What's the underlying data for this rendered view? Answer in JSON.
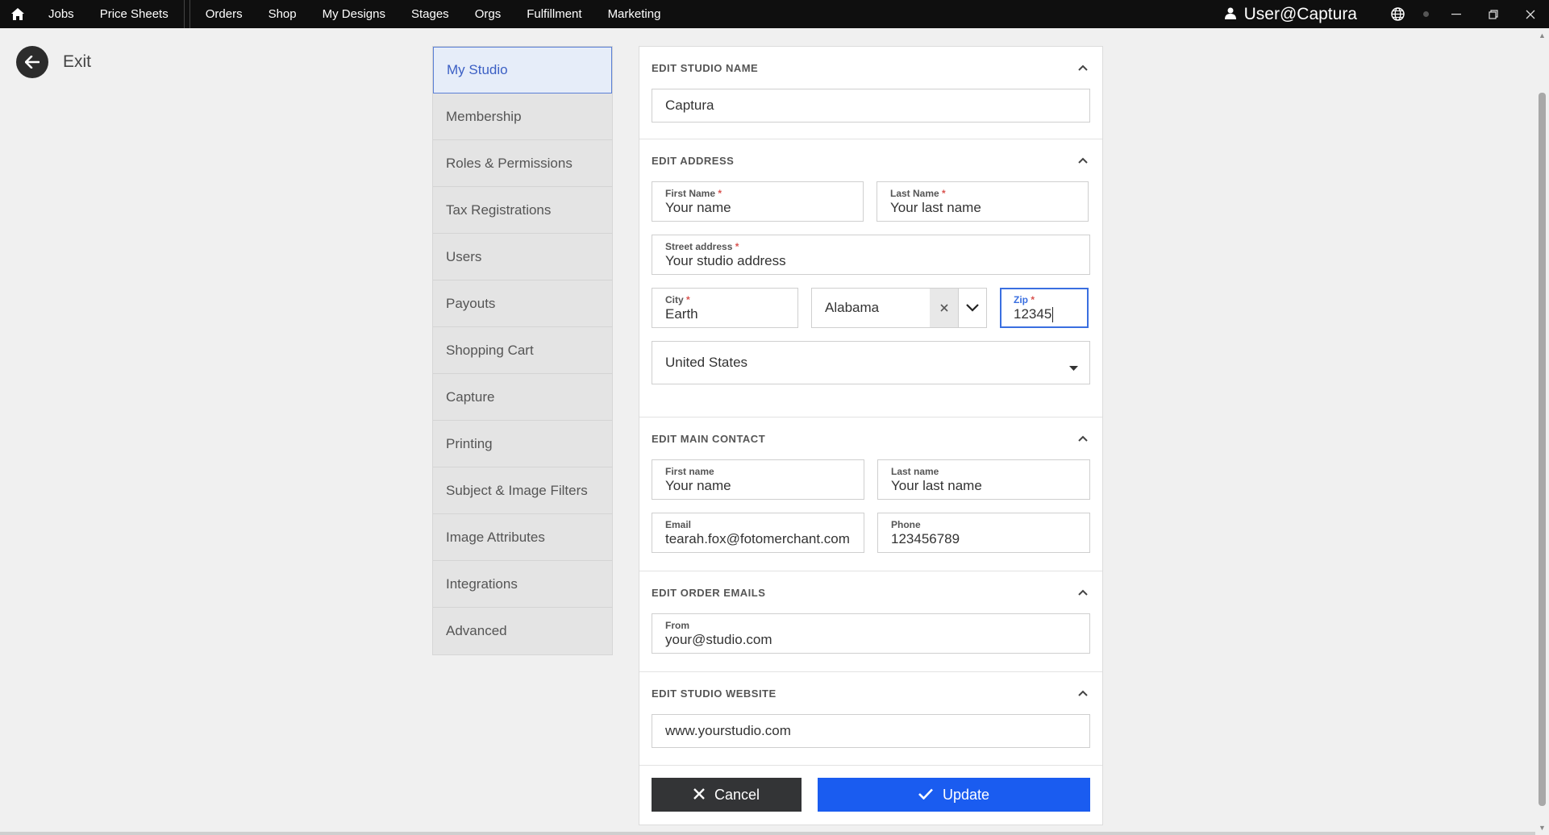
{
  "topbar": {
    "nav": [
      "Jobs",
      "Price Sheets",
      "Orders",
      "Shop",
      "My Designs",
      "Stages",
      "Orgs",
      "Fulfillment",
      "Marketing"
    ],
    "user": "User@Captura"
  },
  "exit_label": "Exit",
  "sidebar": {
    "items": [
      {
        "label": "My Studio",
        "active": true
      },
      {
        "label": "Membership"
      },
      {
        "label": "Roles & Permissions"
      },
      {
        "label": "Tax Registrations"
      },
      {
        "label": "Users"
      },
      {
        "label": "Payouts"
      },
      {
        "label": "Shopping Cart"
      },
      {
        "label": "Capture"
      },
      {
        "label": "Printing"
      },
      {
        "label": "Subject & Image Filters"
      },
      {
        "label": "Image Attributes"
      },
      {
        "label": "Integrations"
      },
      {
        "label": "Advanced"
      }
    ]
  },
  "studio_name": {
    "heading": "EDIT STUDIO NAME",
    "value": "Captura"
  },
  "address": {
    "heading": "EDIT ADDRESS",
    "first_name_label": "First Name",
    "first_name": "Your name",
    "last_name_label": "Last Name",
    "last_name": "Your last name",
    "street_label": "Street address",
    "street": "Your studio address",
    "city_label": "City",
    "city": "Earth",
    "state": "Alabama",
    "zip_label": "Zip",
    "zip": "12345",
    "country": "United States",
    "required_mark": "*"
  },
  "contact": {
    "heading": "EDIT MAIN CONTACT",
    "first_name_label": "First name",
    "first_name": "Your name",
    "last_name_label": "Last name",
    "last_name": "Your last name",
    "email_label": "Email",
    "email": "tearah.fox@fotomerchant.com",
    "phone_label": "Phone",
    "phone": "123456789"
  },
  "order_emails": {
    "heading": "EDIT ORDER EMAILS",
    "from_label": "From",
    "from": "your@studio.com"
  },
  "website": {
    "heading": "EDIT STUDIO WEBSITE",
    "value": "www.yourstudio.com"
  },
  "buttons": {
    "cancel": "Cancel",
    "update": "Update"
  },
  "colors": {
    "topbar": "#0f0f0f",
    "accent": "#1a5cf0",
    "cancel": "#333436",
    "active_item": "#3b5fc4",
    "required": "#d9534f"
  }
}
